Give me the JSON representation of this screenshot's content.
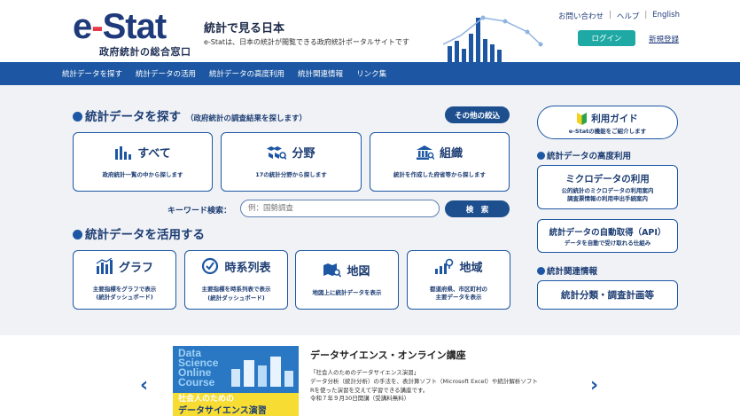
{
  "header": {
    "logo": "e-Stat",
    "logo_sub": "政府統計の総合窓口",
    "site_title": "統計で見る日本",
    "site_desc": "e-Statは、日本の統計が閲覧できる政府統計ポータルサイトです",
    "links": [
      "お問い合わせ",
      "ヘルプ",
      "English"
    ],
    "login": "ログイン",
    "register": "新規登録"
  },
  "nav": [
    "統計データを探す",
    "統計データの活用",
    "統計データの高度利用",
    "統計関連情報",
    "リンク集"
  ],
  "search_section": {
    "title": "統計データを探す",
    "subtitle": "（政府統計の調査結果を探します）",
    "narrow_button": "その他の絞込",
    "cards": [
      {
        "title": "すべて",
        "desc": "政府統計一覧の中から探します",
        "icon": "bar-chart-icon"
      },
      {
        "title": "分野",
        "desc": "17の統計分野から探します",
        "icon": "cubes-icon"
      },
      {
        "title": "組織",
        "desc": "統計を作成した府省等から探します",
        "icon": "building-icon"
      }
    ],
    "keyword_label": "キーワード検索：",
    "keyword_placeholder": "例：国勢調査",
    "search_button": "検　索"
  },
  "use_section": {
    "title": "統計データを活用する",
    "cards": [
      {
        "title": "グラフ",
        "desc": [
          "主要指標をグラフで表示",
          "(統計ダッシュボード)"
        ],
        "icon": "graph-icon"
      },
      {
        "title": "時系列表",
        "desc": [
          "主要指標を時系列表で表示",
          "(統計ダッシュボード)"
        ],
        "icon": "clock-icon"
      },
      {
        "title": "地図",
        "desc": [
          "地図上に統計データを表示"
        ],
        "icon": "map-icon"
      },
      {
        "title": "地域",
        "desc": [
          "都道府県、市区町村の",
          "主要データを表示"
        ],
        "icon": "region-icon"
      }
    ]
  },
  "right": {
    "guide": {
      "title": "利用ガイド",
      "desc": "e-Statの機能をご紹介します"
    },
    "advanced_heading": "統計データの高度利用",
    "micro": {
      "title": "ミクロデータの利用",
      "desc": [
        "公的統計のミクロデータの利用案内",
        "調査票情報の利用申出手続案内"
      ]
    },
    "api": {
      "title": "統計データの自動取得（API）",
      "desc": "データを自動で受け取れる仕組み"
    },
    "related_heading": "統計関連情報",
    "classification": {
      "title": "統計分類・調査計画等"
    }
  },
  "banner": {
    "image_text": [
      "Data",
      "Science",
      "Online",
      "Course"
    ],
    "image_sub1": "社会人のための",
    "image_sub2": "データサイエンス演習",
    "title": "データサイエンス・オンライン講座",
    "desc": [
      "「社会人のためのデータサイエンス演習」",
      "データ分析（統計分析）の手法を、表計算ソフト（Microsoft Excel）や統計解析ソフト",
      "Rを使った演習を交えて学習できる講座です。",
      "令和７年９月30日開講（受講料無料）"
    ],
    "prev": "‹",
    "next": "›"
  },
  "colors": {
    "primary": "#1d57a3",
    "accent": "#e8394a",
    "teal": "#1fa9a5"
  }
}
